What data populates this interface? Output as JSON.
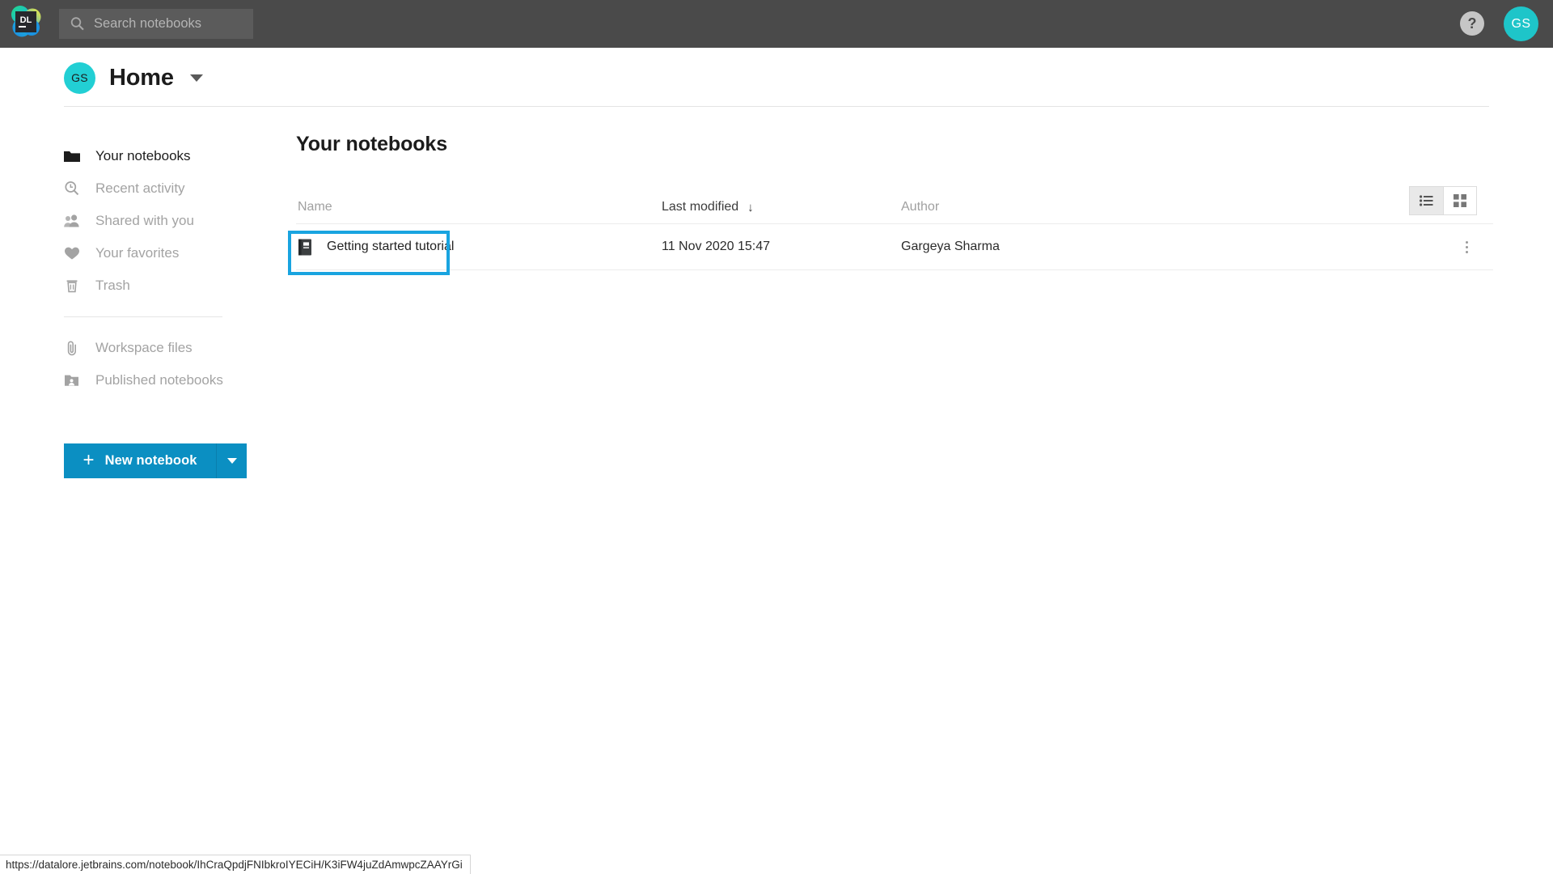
{
  "topbar": {
    "logo_name": "datalore-logo",
    "logo_text": "DL",
    "search_placeholder": "Search notebooks",
    "search_value": "",
    "help_label": "?",
    "avatar_initials": "GS"
  },
  "header": {
    "avatar_initials": "GS",
    "title": "Home"
  },
  "sidebar": {
    "items": [
      {
        "label": "Your notebooks",
        "icon": "folder-icon",
        "active": true
      },
      {
        "label": "Recent activity",
        "icon": "recent-clock-search-icon",
        "active": false
      },
      {
        "label": "Shared with you",
        "icon": "people-icon",
        "active": false
      },
      {
        "label": "Your favorites",
        "icon": "heart-icon",
        "active": false
      },
      {
        "label": "Trash",
        "icon": "trash-icon",
        "active": false
      }
    ],
    "secondary_items": [
      {
        "label": "Workspace files",
        "icon": "paperclip-icon"
      },
      {
        "label": "Published notebooks",
        "icon": "published-folder-icon"
      }
    ],
    "new_notebook_label": "New notebook",
    "new_notebook_plus": "+",
    "accent_color": "#0b8fc2"
  },
  "main": {
    "title": "Your notebooks",
    "columns": [
      {
        "label": "Name",
        "sorted": false
      },
      {
        "label": "Last modified",
        "sorted": true,
        "sort_direction": "desc",
        "sort_glyph": "↓"
      },
      {
        "label": "Author",
        "sorted": false
      }
    ],
    "rows": [
      {
        "name": "Getting started tutorial",
        "icon": "notebook-icon",
        "last_modified": "11 Nov 2020 15:47",
        "author": "Gargeya Sharma",
        "highlighted": true
      }
    ],
    "view_modes": [
      {
        "name": "list-view",
        "active": true
      },
      {
        "name": "grid-view",
        "active": false
      }
    ],
    "highlight_color": "#19a4e0"
  },
  "statusbar": {
    "url": "https://datalore.jetbrains.com/notebook/IhCraQpdjFNIbkroIYECiH/K3iFW4juZdAmwpcZAAYrGi"
  }
}
